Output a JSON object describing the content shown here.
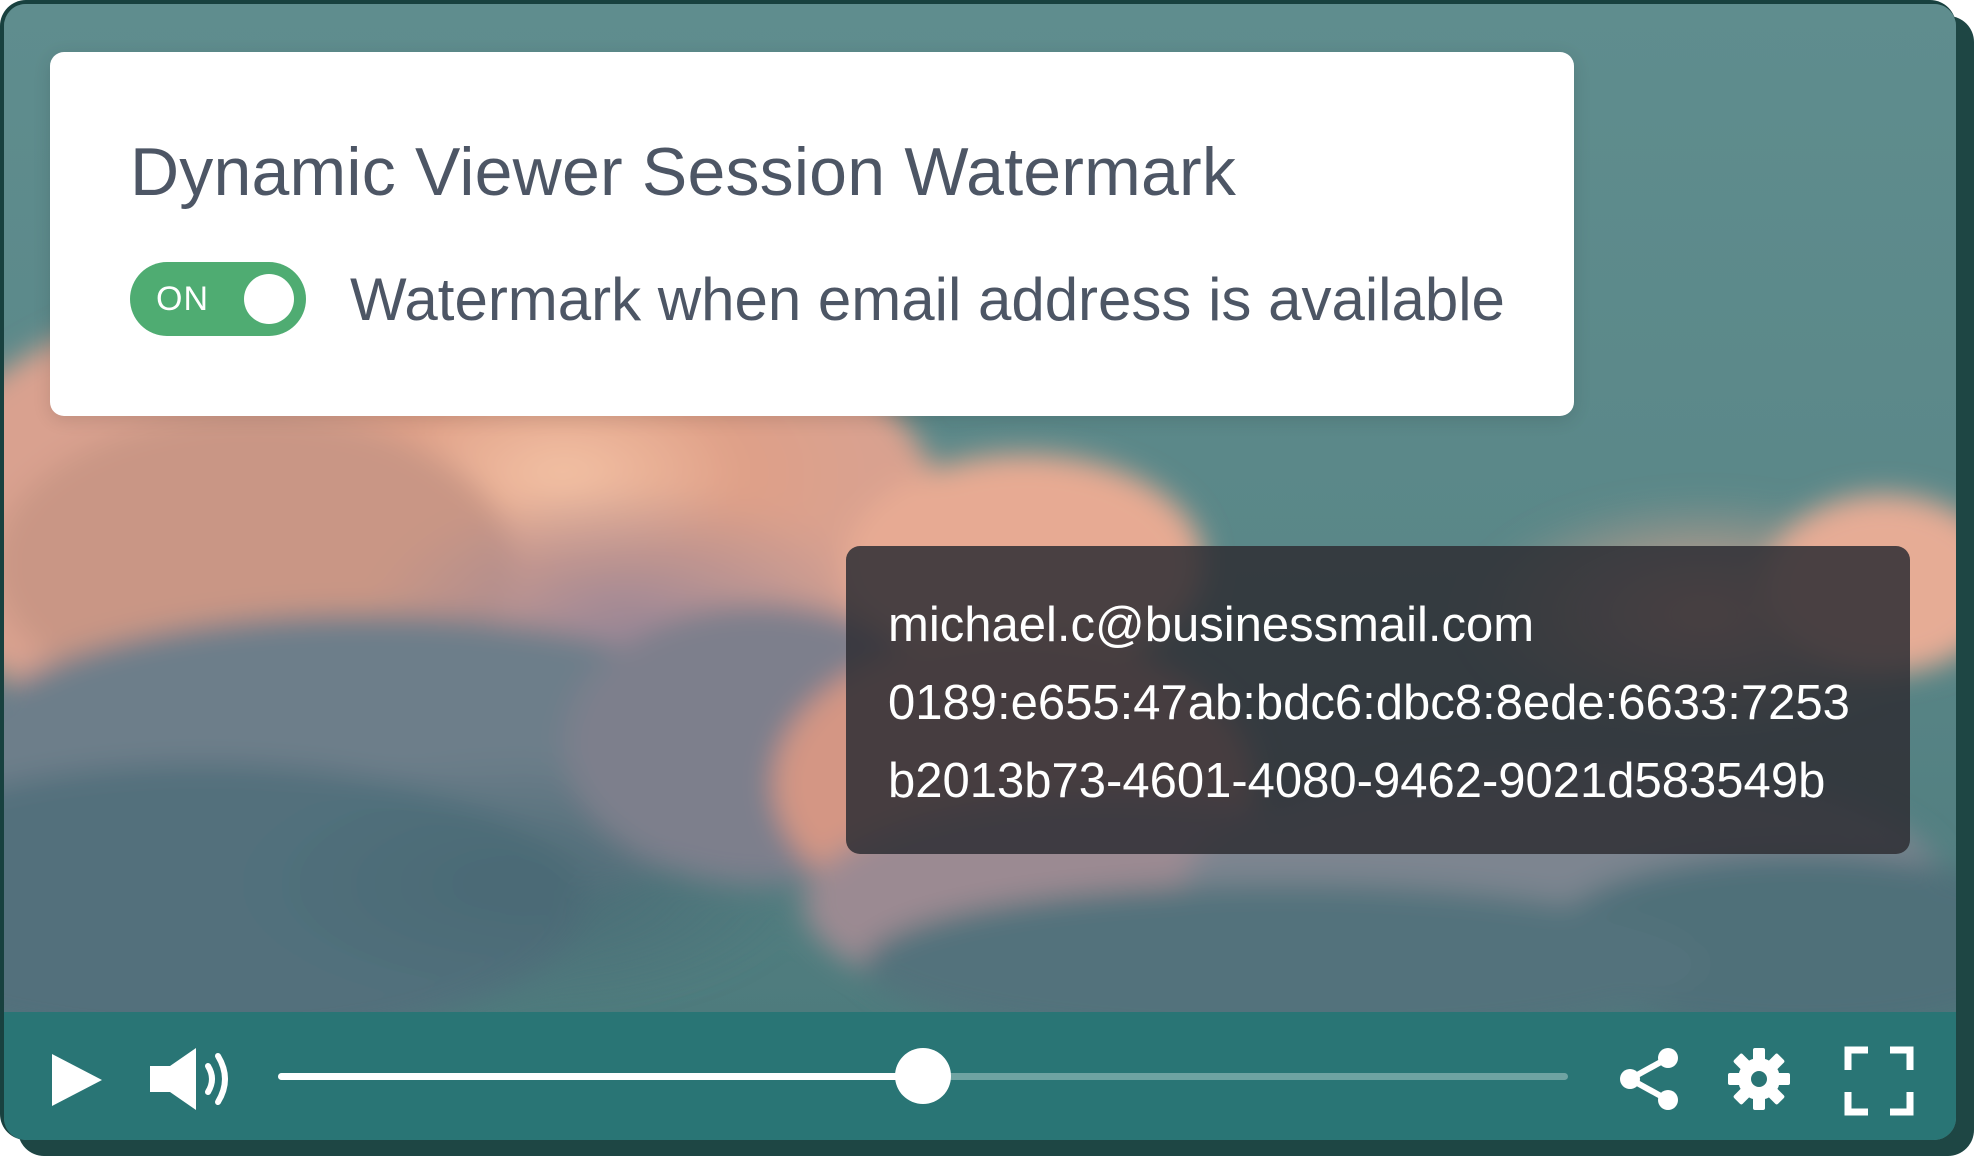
{
  "settings_panel": {
    "title": "Dynamic Viewer Session Watermark",
    "toggle": {
      "state_label": "ON",
      "is_on": true,
      "description": "Watermark when email address is available"
    }
  },
  "watermark": {
    "lines": [
      "michael.c@businessmail.com",
      "0189:e655:47ab:bdc6:dbc8:8ede:6633:7253",
      "b2013b73-4601-4080-9462-9021d583549b"
    ]
  },
  "player_controls": {
    "progress_fraction": 0.5,
    "icons": [
      "play-icon",
      "volume-icon",
      "share-icon",
      "gear-icon",
      "fullscreen-icon"
    ]
  },
  "colors": {
    "toggle_on": "#4fac72",
    "control_bar": "#297575",
    "text_primary": "#4d5665",
    "watermark_bg": "#2e2e34"
  }
}
